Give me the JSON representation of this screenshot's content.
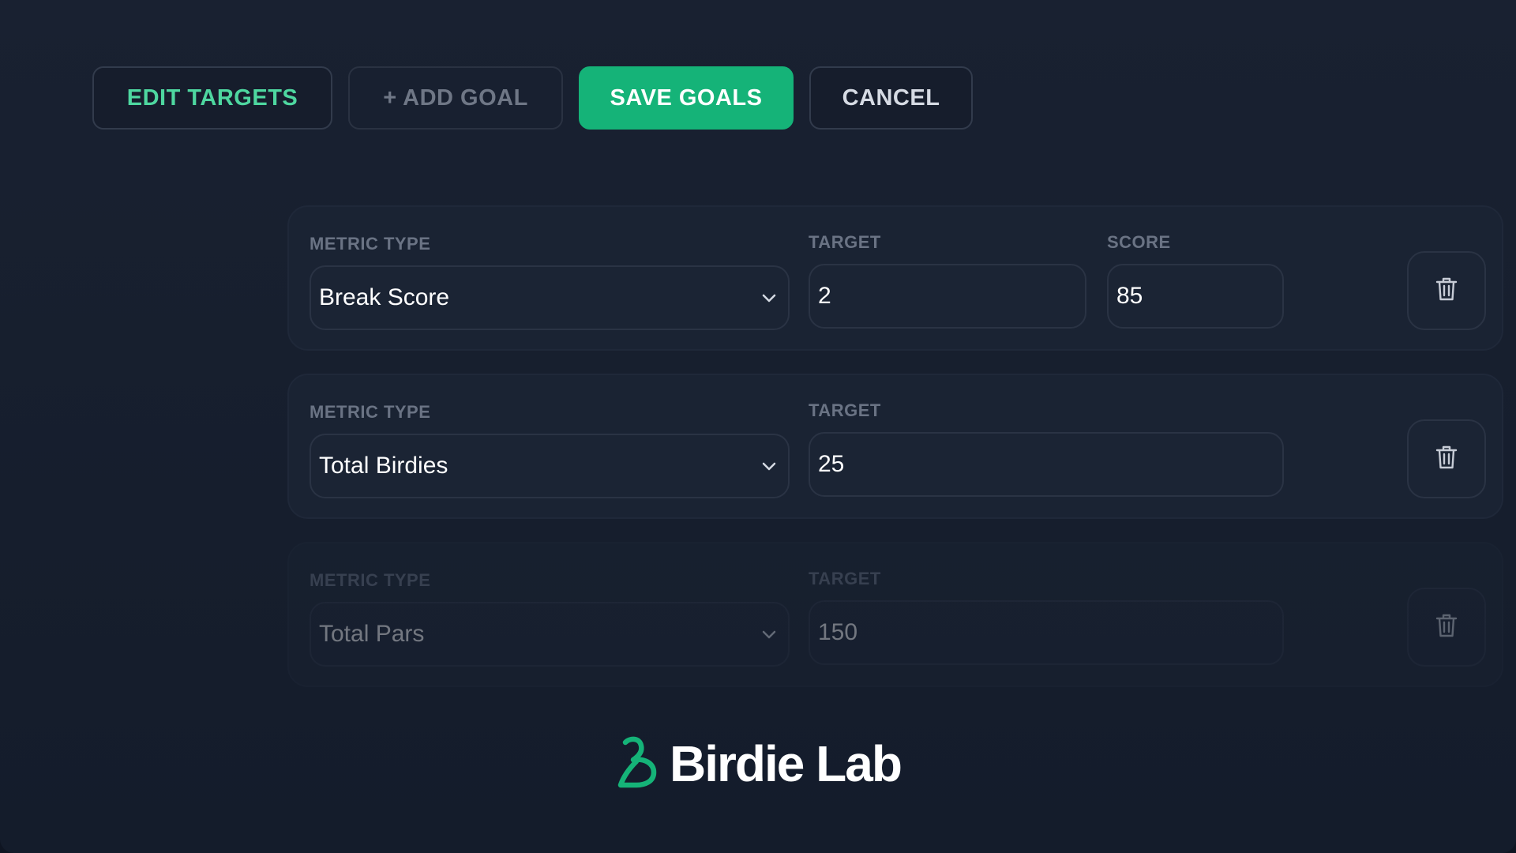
{
  "toolbar": {
    "edit_targets_label": "EDIT TARGETS",
    "add_goal_label": "+ ADD GOAL",
    "save_goals_label": "SAVE GOALS",
    "cancel_label": "CANCEL"
  },
  "goals": [
    {
      "metric_label": "METRIC TYPE",
      "metric_value": "Break Score",
      "target_label": "TARGET",
      "target_value": "2",
      "score_label": "SCORE",
      "score_value": "85"
    },
    {
      "metric_label": "METRIC TYPE",
      "metric_value": "Total Birdies",
      "target_label": "TARGET",
      "target_value": "25"
    },
    {
      "metric_label": "METRIC TYPE",
      "metric_value": "Total Pars",
      "target_label": "TARGET",
      "target_value": "150"
    }
  ],
  "brand": {
    "name": "Birdie Lab"
  },
  "icons": {
    "dropdown": "chevron-down-icon",
    "delete": "trash-icon",
    "logo": "birdie-lab-logo-icon"
  },
  "colors": {
    "accent": "#15b378",
    "accent_text": "#4ed7a0",
    "background": "#192131",
    "card": "#1a2333"
  }
}
